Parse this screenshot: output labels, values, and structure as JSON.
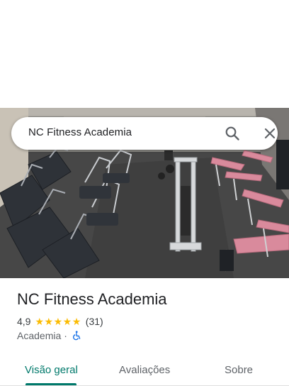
{
  "search": {
    "query": "NC Fitness Academia"
  },
  "place": {
    "title": "NC Fitness Academia",
    "rating": "4,9",
    "stars": 5,
    "review_count": "(31)",
    "category": "Academia",
    "separator": "·"
  },
  "tabs": [
    {
      "label": "Visão geral",
      "active": true
    },
    {
      "label": "Avaliações",
      "active": false
    },
    {
      "label": "Sobre",
      "active": false
    }
  ],
  "colors": {
    "accent": "#00796b",
    "star": "#fbbc04",
    "accessibility": "#1a73e8"
  },
  "icons": {
    "search": "search-icon",
    "close": "close-icon",
    "wheelchair": "wheelchair-icon",
    "star": "star-icon"
  }
}
